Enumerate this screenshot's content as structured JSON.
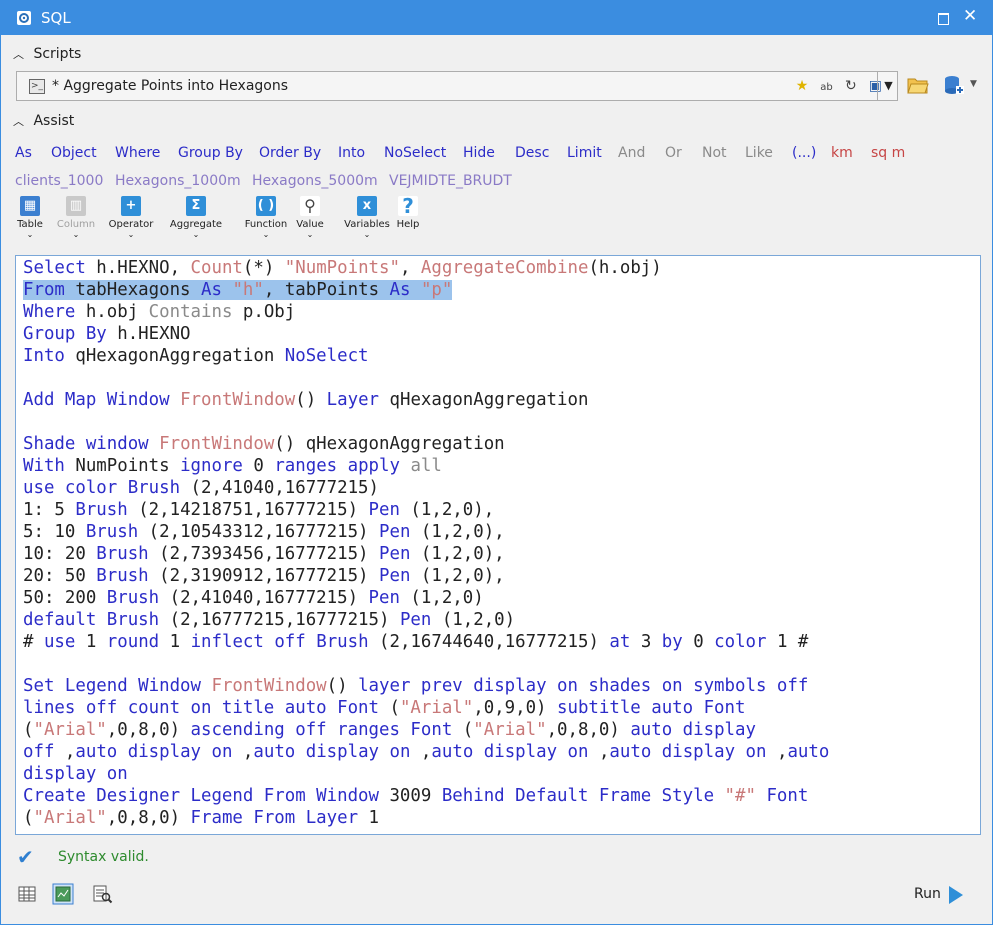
{
  "window": {
    "title": "SQL"
  },
  "sections": {
    "scripts": "Scripts",
    "assist": "Assist"
  },
  "script_combo": {
    "value": "* Aggregate Points into Hexagons"
  },
  "assist_keywords": [
    {
      "label": "As",
      "color": "blue"
    },
    {
      "label": "Object",
      "color": "blue"
    },
    {
      "label": "Where",
      "color": "blue"
    },
    {
      "label": "Group By",
      "color": "blue"
    },
    {
      "label": "Order By",
      "color": "blue"
    },
    {
      "label": "Into",
      "color": "blue"
    },
    {
      "label": "NoSelect",
      "color": "blue"
    },
    {
      "label": "Hide",
      "color": "blue"
    },
    {
      "label": "Desc",
      "color": "blue"
    },
    {
      "label": "Limit",
      "color": "blue"
    },
    {
      "label": "And",
      "color": "gray"
    },
    {
      "label": "Or",
      "color": "gray"
    },
    {
      "label": "Not",
      "color": "gray"
    },
    {
      "label": "Like",
      "color": "gray"
    },
    {
      "label": "(...)",
      "color": "blue"
    },
    {
      "label": "km",
      "color": "red"
    },
    {
      "label": "sq m",
      "color": "red"
    }
  ],
  "assist_tables": [
    "clients_1000",
    "Hexagons_1000m",
    "Hexagons_5000m",
    "VEJMIDTE_BRUDT"
  ],
  "toolbar": [
    {
      "label": "Table",
      "icon": "table-icon",
      "enabled": true
    },
    {
      "label": "Column",
      "icon": "column-icon",
      "enabled": false
    },
    {
      "label": "Operator",
      "icon": "operator-icon",
      "enabled": true
    },
    {
      "label": "Aggregate",
      "icon": "sigma-icon",
      "enabled": true
    },
    {
      "label": "Function",
      "icon": "parentheses-icon",
      "enabled": true
    },
    {
      "label": "Value",
      "icon": "magnifier-icon",
      "enabled": true
    },
    {
      "label": "Variables",
      "icon": "variables-icon",
      "enabled": true
    },
    {
      "label": "Help",
      "icon": "help-icon",
      "enabled": true
    }
  ],
  "code_lines": [
    [
      [
        "b",
        "Select"
      ],
      [
        "n",
        " h.HEXNO, "
      ],
      [
        "r",
        "Count"
      ],
      [
        "n",
        "(*) "
      ],
      [
        "r",
        "\"NumPoints\""
      ],
      [
        "n",
        ", "
      ],
      [
        "r",
        "AggregateCombine"
      ],
      [
        "n",
        "(h.obj)"
      ]
    ],
    [
      [
        "b",
        "From"
      ],
      [
        "n",
        " tabHexagons "
      ],
      [
        "b",
        "As"
      ],
      [
        "n",
        " "
      ],
      [
        "r",
        "\"h\""
      ],
      [
        "n",
        ", tabPoints "
      ],
      [
        "b",
        "As"
      ],
      [
        "n",
        " "
      ],
      [
        "r",
        "\"p\""
      ]
    ],
    [
      [
        "b",
        "Where"
      ],
      [
        "n",
        " h.obj "
      ],
      [
        "g",
        "Contains"
      ],
      [
        "n",
        " p.Obj"
      ]
    ],
    [
      [
        "b",
        "Group By"
      ],
      [
        "n",
        " h.HEXNO"
      ]
    ],
    [
      [
        "b",
        "Into"
      ],
      [
        "n",
        " qHexagonAggregation "
      ],
      [
        "b",
        "NoSelect"
      ]
    ],
    [],
    [
      [
        "b",
        "Add Map Window"
      ],
      [
        "n",
        " "
      ],
      [
        "r",
        "FrontWindow"
      ],
      [
        "n",
        "() "
      ],
      [
        "b",
        "Layer"
      ],
      [
        "n",
        " qHexagonAggregation"
      ]
    ],
    [],
    [
      [
        "b",
        "Shade window"
      ],
      [
        "n",
        " "
      ],
      [
        "r",
        "FrontWindow"
      ],
      [
        "n",
        "() qHexagonAggregation"
      ]
    ],
    [
      [
        "b",
        "With"
      ],
      [
        "n",
        " NumPoints "
      ],
      [
        "b",
        "ignore"
      ],
      [
        "n",
        " 0 "
      ],
      [
        "b",
        "ranges apply"
      ],
      [
        "n",
        " "
      ],
      [
        "g",
        "all"
      ]
    ],
    [
      [
        "b",
        "use color Brush"
      ],
      [
        "n",
        " (2,41040,16777215)"
      ]
    ],
    [
      [
        "n",
        "1: 5 "
      ],
      [
        "b",
        "Brush"
      ],
      [
        "n",
        " (2,14218751,16777215) "
      ],
      [
        "b",
        "Pen"
      ],
      [
        "n",
        " (1,2,0),"
      ]
    ],
    [
      [
        "n",
        "5: 10 "
      ],
      [
        "b",
        "Brush"
      ],
      [
        "n",
        " (2,10543312,16777215) "
      ],
      [
        "b",
        "Pen"
      ],
      [
        "n",
        " (1,2,0),"
      ]
    ],
    [
      [
        "n",
        "10: 20 "
      ],
      [
        "b",
        "Brush"
      ],
      [
        "n",
        " (2,7393456,16777215) "
      ],
      [
        "b",
        "Pen"
      ],
      [
        "n",
        " (1,2,0),"
      ]
    ],
    [
      [
        "n",
        "20: 50 "
      ],
      [
        "b",
        "Brush"
      ],
      [
        "n",
        " (2,3190912,16777215) "
      ],
      [
        "b",
        "Pen"
      ],
      [
        "n",
        " (1,2,0),"
      ]
    ],
    [
      [
        "n",
        "50: 200 "
      ],
      [
        "b",
        "Brush"
      ],
      [
        "n",
        " (2,41040,16777215) "
      ],
      [
        "b",
        "Pen"
      ],
      [
        "n",
        " (1,2,0)"
      ]
    ],
    [
      [
        "b",
        "default Brush"
      ],
      [
        "n",
        " (2,16777215,16777215) "
      ],
      [
        "b",
        "Pen"
      ],
      [
        "n",
        " (1,2,0)"
      ]
    ],
    [
      [
        "n",
        "# "
      ],
      [
        "b",
        "use"
      ],
      [
        "n",
        " 1 "
      ],
      [
        "b",
        "round"
      ],
      [
        "n",
        " 1 "
      ],
      [
        "b",
        "inflect off Brush"
      ],
      [
        "n",
        " (2,16744640,16777215) "
      ],
      [
        "b",
        "at"
      ],
      [
        "n",
        " 3 "
      ],
      [
        "b",
        "by"
      ],
      [
        "n",
        " 0 "
      ],
      [
        "b",
        "color"
      ],
      [
        "n",
        " 1 #"
      ]
    ],
    [],
    [
      [
        "b",
        "Set Legend Window"
      ],
      [
        "n",
        " "
      ],
      [
        "r",
        "FrontWindow"
      ],
      [
        "n",
        "() "
      ],
      [
        "b",
        "layer prev display on shades on symbols off"
      ]
    ],
    [
      [
        "b",
        "lines off count on title auto Font"
      ],
      [
        "n",
        " ("
      ],
      [
        "r",
        "\"Arial\""
      ],
      [
        "n",
        ",0,9,0) "
      ],
      [
        "b",
        "subtitle auto Font"
      ]
    ],
    [
      [
        "n",
        "("
      ],
      [
        "r",
        "\"Arial\""
      ],
      [
        "n",
        ",0,8,0) "
      ],
      [
        "b",
        "ascending off ranges Font"
      ],
      [
        "n",
        " ("
      ],
      [
        "r",
        "\"Arial\""
      ],
      [
        "n",
        ",0,8,0) "
      ],
      [
        "b",
        "auto display"
      ]
    ],
    [
      [
        "b",
        "off"
      ],
      [
        "n",
        " ,"
      ],
      [
        "b",
        "auto display on"
      ],
      [
        "n",
        " ,"
      ],
      [
        "b",
        "auto display on"
      ],
      [
        "n",
        " ,"
      ],
      [
        "b",
        "auto display on"
      ],
      [
        "n",
        " ,"
      ],
      [
        "b",
        "auto display on"
      ],
      [
        "n",
        " ,"
      ],
      [
        "b",
        "auto"
      ]
    ],
    [
      [
        "b",
        "display on"
      ]
    ],
    [
      [
        "b",
        "Create Designer Legend From Window"
      ],
      [
        "n",
        " 3009 "
      ],
      [
        "b",
        "Behind Default Frame Style"
      ],
      [
        "n",
        " "
      ],
      [
        "r",
        "\"#\""
      ],
      [
        "n",
        " "
      ],
      [
        "b",
        "Font"
      ]
    ],
    [
      [
        "n",
        "("
      ],
      [
        "r",
        "\"Arial\""
      ],
      [
        "n",
        ",0,8,0) "
      ],
      [
        "b",
        "Frame From Layer"
      ],
      [
        "n",
        " 1"
      ]
    ]
  ],
  "highlighted_line": 1,
  "status": {
    "message": "Syntax valid."
  },
  "run": {
    "label": "Run"
  },
  "colors": {
    "accent": "#3b8de0",
    "keyword": "#2c2cc8",
    "function": "#c87878",
    "operator": "#8a8a8a",
    "valid": "#2e8b2e",
    "table_name": "#8a7ac6"
  }
}
